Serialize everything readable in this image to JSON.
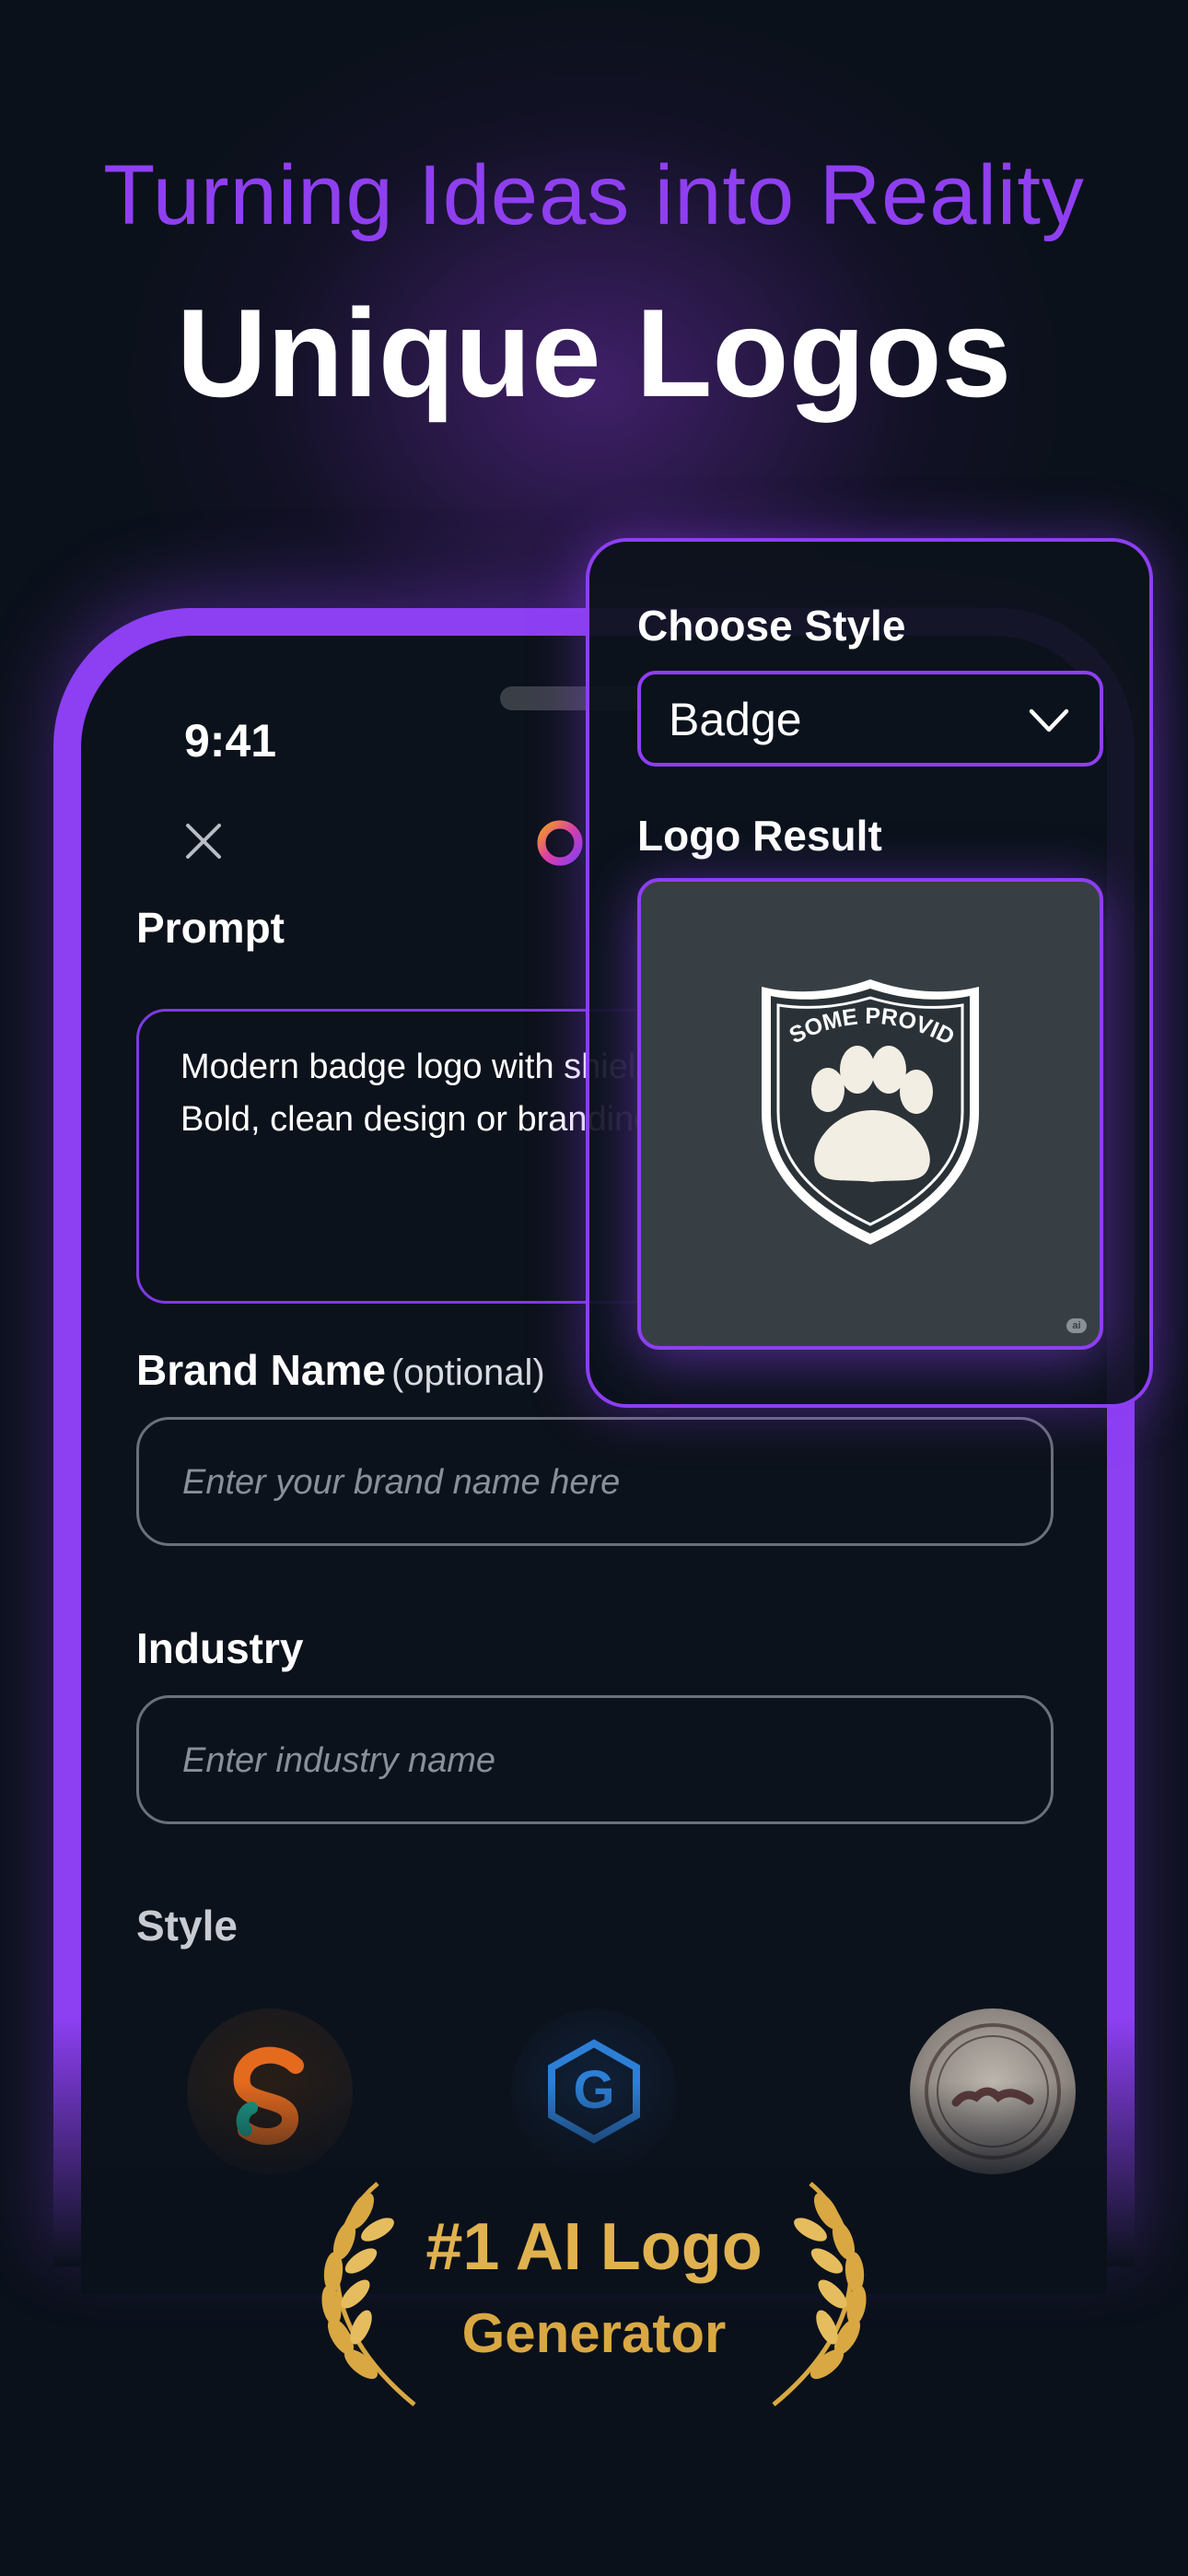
{
  "hero": {
    "tagline": "Turning Ideas into Reality",
    "headline": "Unique Logos"
  },
  "status_bar": {
    "time": "9:41"
  },
  "form": {
    "prompt_label": "Prompt",
    "prompt_text": "Modern badge logo with shield and 'PAWSOME PR top. Bold, clean design or branding.",
    "brand_label": "Brand Name",
    "brand_optional": "(optional)",
    "brand_placeholder": "Enter your brand name here",
    "industry_label": "Industry",
    "industry_placeholder": "Enter industry name",
    "style_label": "Style"
  },
  "style_card": {
    "choose_label": "Choose Style",
    "selected_style": "Badge",
    "result_label": "Logo Result",
    "badge_text": "PAWSOME PROVIDERS"
  },
  "award": {
    "title": "#1 AI Logo",
    "subtitle": "Generator"
  },
  "colors": {
    "accent": "#8d3ff2",
    "background": "#0b111b",
    "gold": "#e0b24f"
  }
}
